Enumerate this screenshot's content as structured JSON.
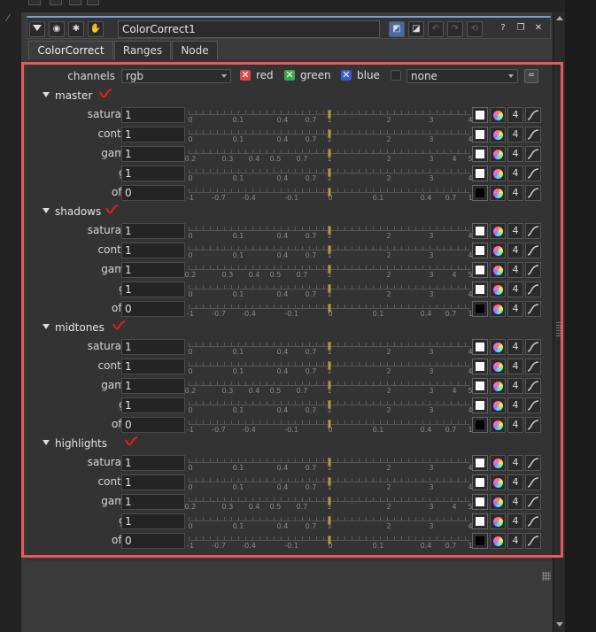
{
  "node": {
    "name": "ColorCorrect1"
  },
  "tabs": [
    "ColorCorrect",
    "Ranges",
    "Node"
  ],
  "channels": {
    "label": "channels",
    "value": "rgb",
    "red": "red",
    "green": "green",
    "blue": "blue",
    "extra_value": "none"
  },
  "sliders": {
    "pos_ticks": [
      "0",
      "0.1",
      "0.4",
      "0.7",
      "1",
      "2",
      "3",
      "4"
    ],
    "gamma_ticks": [
      "0.2",
      "0.3",
      "0.4",
      "0.5",
      "0.7",
      "1",
      "2",
      "3",
      "4",
      "5"
    ],
    "offset_ticks": [
      "-1",
      "-0.7",
      "-0.4",
      "-0.1",
      "0",
      "0.1",
      "0.4",
      "0.7",
      "1"
    ]
  },
  "sections": [
    {
      "name": "master",
      "params": [
        {
          "label": "saturation",
          "value": "1",
          "type": "pos",
          "swatch": "#ffffff"
        },
        {
          "label": "contrast",
          "value": "1",
          "type": "pos",
          "swatch": "#ffffff"
        },
        {
          "label": "gamma",
          "value": "1",
          "type": "gamma",
          "swatch": "#ffffff"
        },
        {
          "label": "gain",
          "value": "1",
          "type": "pos",
          "swatch": "#ffffff"
        },
        {
          "label": "offset",
          "value": "0",
          "type": "offset",
          "swatch": "#000000"
        }
      ]
    },
    {
      "name": "shadows",
      "params": [
        {
          "label": "saturation",
          "value": "1",
          "type": "pos",
          "swatch": "#ffffff"
        },
        {
          "label": "contrast",
          "value": "1",
          "type": "pos",
          "swatch": "#ffffff"
        },
        {
          "label": "gamma",
          "value": "1",
          "type": "gamma",
          "swatch": "#ffffff"
        },
        {
          "label": "gain",
          "value": "1",
          "type": "pos",
          "swatch": "#ffffff"
        },
        {
          "label": "offset",
          "value": "0",
          "type": "offset",
          "swatch": "#000000"
        }
      ]
    },
    {
      "name": "midtones",
      "params": [
        {
          "label": "saturation",
          "value": "1",
          "type": "pos",
          "swatch": "#ffffff"
        },
        {
          "label": "contrast",
          "value": "1",
          "type": "pos",
          "swatch": "#ffffff"
        },
        {
          "label": "gamma",
          "value": "1",
          "type": "gamma",
          "swatch": "#ffffff"
        },
        {
          "label": "gain",
          "value": "1",
          "type": "pos",
          "swatch": "#ffffff"
        },
        {
          "label": "offset",
          "value": "0",
          "type": "offset",
          "swatch": "#000000"
        }
      ]
    },
    {
      "name": "highlights",
      "params": [
        {
          "label": "saturation",
          "value": "1",
          "type": "pos",
          "swatch": "#ffffff"
        },
        {
          "label": "contrast",
          "value": "1",
          "type": "pos",
          "swatch": "#ffffff"
        },
        {
          "label": "gamma",
          "value": "1",
          "type": "gamma",
          "swatch": "#ffffff"
        },
        {
          "label": "gain",
          "value": "1",
          "type": "pos",
          "swatch": "#ffffff"
        },
        {
          "label": "offset",
          "value": "0",
          "type": "offset",
          "swatch": "#000000"
        }
      ]
    }
  ],
  "icons": {
    "channel_button": "4",
    "highlight_color": "#e85a5a",
    "handle_color": "#b59c4a"
  }
}
